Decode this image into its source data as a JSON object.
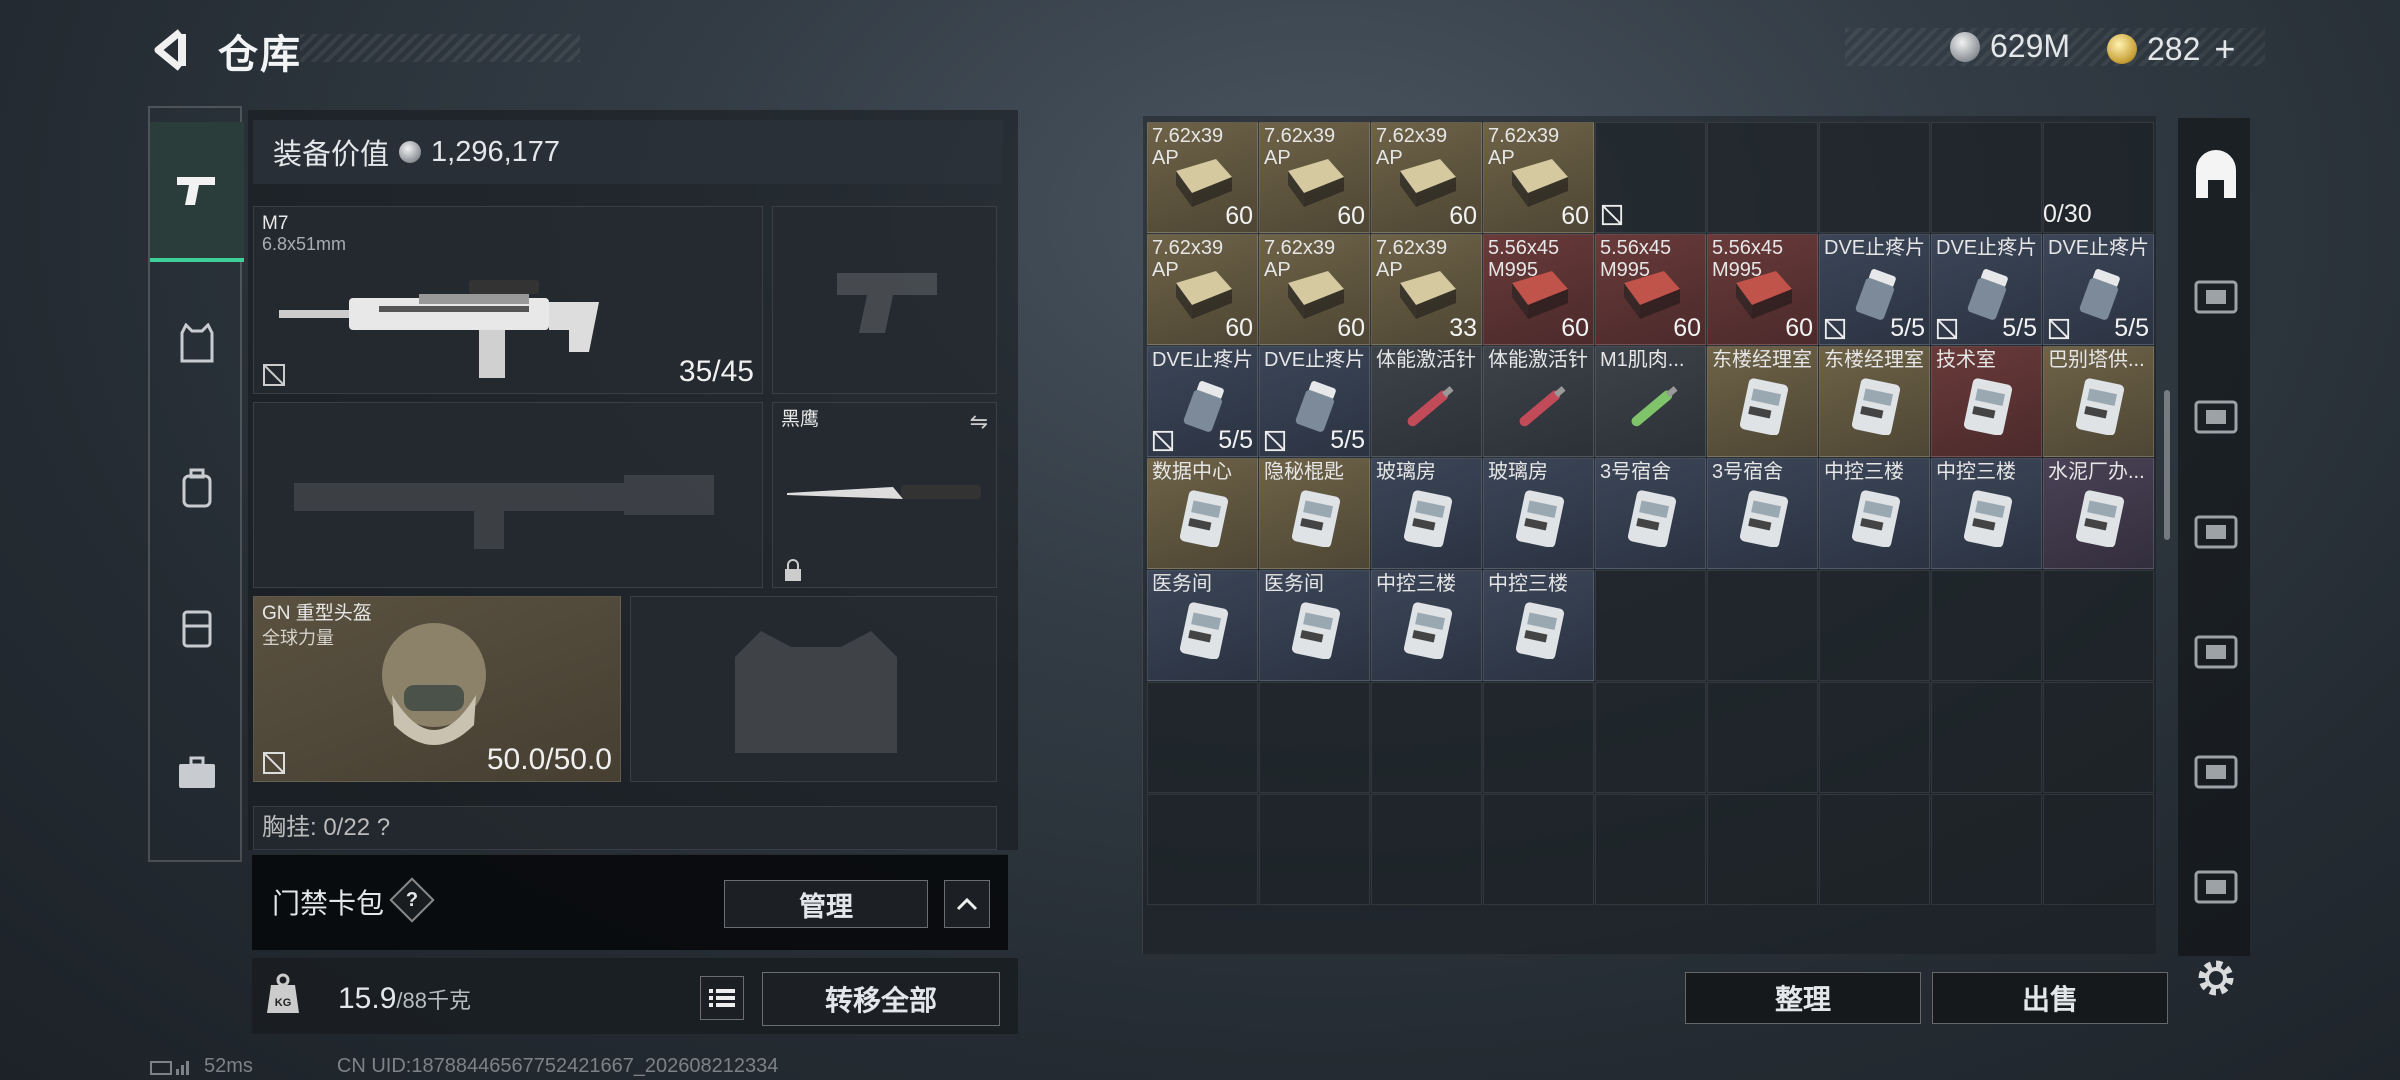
{
  "header": {
    "title": "仓库",
    "currency_silver": "629M",
    "currency_gold": "282"
  },
  "colors": {
    "accent": "#3fd09a",
    "gold_quality": "#6e6348",
    "red_quality": "#6a3a3a",
    "blue_quality": "#3c4658"
  },
  "sidebar": {
    "items": [
      {
        "icon": "pistol-icon",
        "active": true
      },
      {
        "icon": "armor-icon",
        "active": false
      },
      {
        "icon": "backpack-icon",
        "active": false
      },
      {
        "icon": "chest-rig-icon",
        "active": false
      },
      {
        "icon": "briefcase-icon",
        "active": false
      }
    ]
  },
  "equipment": {
    "value_label": "装备价值",
    "value": "1,296,177",
    "primary_name": "M7",
    "primary_caliber": "6.8x51mm",
    "primary_ammo": "35/45",
    "melee_name": "黑鹰",
    "helmet_name": "GN 重型头盔",
    "helmet_brand": "全球力量",
    "helmet_durability": "50.0/50.0",
    "chest_partial": "胸挂: 0/22 ?"
  },
  "card_pack": {
    "label": "门禁卡包",
    "help": "?",
    "manage": "管理"
  },
  "weight": {
    "current": "15.9",
    "max": "/88千克",
    "transfer_all": "转移全部"
  },
  "status": {
    "ping": "52ms",
    "uid": "CN UID:18788446567752421667_202608212334"
  },
  "grid": {
    "top_right_counter": "0/30",
    "rows": [
      [
        {
          "name": "7.62x39\nAP",
          "count": "60",
          "q": "gold",
          "icon": "ammo-box-icon"
        },
        {
          "name": "7.62x39\nAP",
          "count": "60",
          "q": "gold",
          "icon": "ammo-box-icon"
        },
        {
          "name": "7.62x39\nAP",
          "count": "60",
          "q": "gold",
          "icon": "ammo-box-icon"
        },
        {
          "name": "7.62x39\nAP",
          "count": "60",
          "q": "gold",
          "icon": "ammo-box-icon"
        }
      ],
      [
        {
          "name": "7.62x39\nAP",
          "count": "60",
          "q": "gold",
          "icon": "ammo-box-icon"
        },
        {
          "name": "7.62x39\nAP",
          "count": "60",
          "q": "gold",
          "icon": "ammo-box-icon"
        },
        {
          "name": "7.62x39\nAP",
          "count": "33",
          "q": "gold",
          "icon": "ammo-box-icon"
        },
        {
          "name": "5.56x45\nM995",
          "count": "60",
          "q": "red",
          "icon": "ammo-box-icon"
        },
        {
          "name": "5.56x45\nM995",
          "count": "60",
          "q": "red",
          "icon": "ammo-box-icon"
        },
        {
          "name": "5.56x45\nM995",
          "count": "60",
          "q": "red",
          "icon": "ammo-box-icon"
        },
        {
          "name": "DVE止疼片",
          "count": "5/5",
          "q": "blue",
          "icon": "pill-bottle-icon"
        },
        {
          "name": "DVE止疼片",
          "count": "5/5",
          "q": "blue",
          "icon": "pill-bottle-icon"
        },
        {
          "name": "DVE止疼片",
          "count": "5/5",
          "q": "blue",
          "icon": "pill-bottle-icon"
        }
      ],
      [
        {
          "name": "DVE止疼片",
          "count": "5/5",
          "q": "blue",
          "icon": "pill-bottle-icon"
        },
        {
          "name": "DVE止疼片",
          "count": "5/5",
          "q": "blue",
          "icon": "pill-bottle-icon"
        },
        {
          "name": "体能激活针",
          "count": "",
          "q": "grey",
          "icon": "syringe-icon"
        },
        {
          "name": "体能激活针",
          "count": "",
          "q": "grey",
          "icon": "syringe-icon"
        },
        {
          "name": "M1肌肉...",
          "count": "",
          "q": "grey",
          "icon": "syringe-icon"
        },
        {
          "name": "东楼经理室",
          "count": "",
          "q": "gold",
          "icon": "keycard-icon"
        },
        {
          "name": "东楼经理室",
          "count": "",
          "q": "gold",
          "icon": "keycard-icon"
        },
        {
          "name": "技术室",
          "count": "",
          "q": "red",
          "icon": "keycard-icon"
        },
        {
          "name": "巴别塔供...",
          "count": "",
          "q": "gold",
          "icon": "keycard-icon"
        }
      ],
      [
        {
          "name": "数据中心",
          "count": "",
          "q": "gold",
          "icon": "keycard-icon"
        },
        {
          "name": "隐秘棍匙",
          "count": "",
          "q": "gold",
          "icon": "keycard-icon"
        },
        {
          "name": "玻璃房",
          "count": "",
          "q": "blue",
          "icon": "keycard-icon"
        },
        {
          "name": "玻璃房",
          "count": "",
          "q": "blue",
          "icon": "keycard-icon"
        },
        {
          "name": "3号宿舍",
          "count": "",
          "q": "blue",
          "icon": "keycard-icon"
        },
        {
          "name": "3号宿舍",
          "count": "",
          "q": "blue",
          "icon": "keycard-icon"
        },
        {
          "name": "中控三楼",
          "count": "",
          "q": "blue",
          "icon": "keycard-icon"
        },
        {
          "name": "中控三楼",
          "count": "",
          "q": "blue",
          "icon": "keycard-icon"
        },
        {
          "name": "水泥厂办...",
          "count": "",
          "q": "purple",
          "icon": "keycard-icon"
        }
      ],
      [
        {
          "name": "医务间",
          "count": "",
          "q": "blue",
          "icon": "keycard-icon"
        },
        {
          "name": "医务间",
          "count": "",
          "q": "blue",
          "icon": "keycard-icon"
        },
        {
          "name": "中控三楼",
          "count": "",
          "q": "blue",
          "icon": "keycard-icon"
        },
        {
          "name": "中控三楼",
          "count": "",
          "q": "blue",
          "icon": "keycard-icon"
        }
      ]
    ],
    "tidy": "整理",
    "sell": "出售"
  },
  "right_tabs": [
    "home-icon",
    "case-tab-icon",
    "folder-tab-icon",
    "key-tab-icon",
    "medkit-tab-icon",
    "weapon-tab-icon",
    "ammo-tab-icon"
  ]
}
